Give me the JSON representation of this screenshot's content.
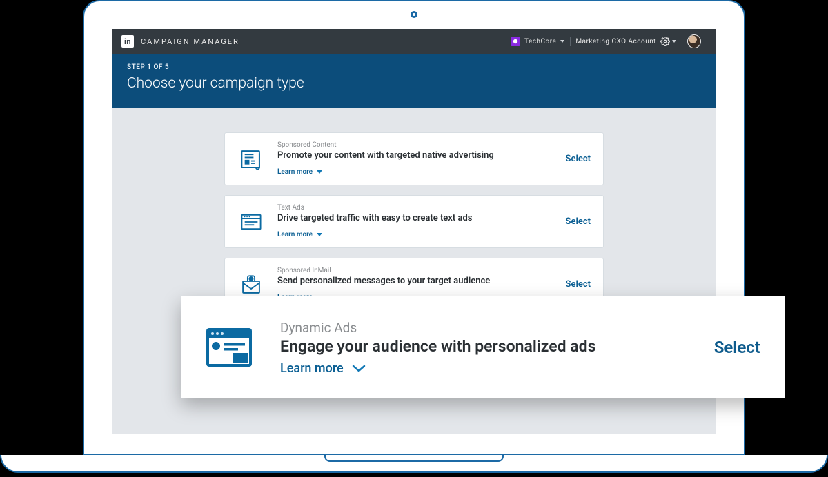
{
  "header": {
    "logo_text": "in",
    "app_title": "CAMPAIGN MANAGER",
    "org_name": "TechCore",
    "account_name": "Marketing CXO Account"
  },
  "step": {
    "label": "STEP 1 OF 5",
    "heading": "Choose your campaign type"
  },
  "common": {
    "learn_more": "Learn more",
    "select": "Select"
  },
  "cards": [
    {
      "eyebrow": "Sponsored Content",
      "title": "Promote your content with targeted native advertising"
    },
    {
      "eyebrow": "Text Ads",
      "title": "Drive targeted traffic with easy to create text ads"
    },
    {
      "eyebrow": "Sponsored InMail",
      "title": "Send personalized messages to your target audience"
    }
  ],
  "overlay": {
    "eyebrow": "Dynamic Ads",
    "title": "Engage your audience with personalized ads"
  }
}
